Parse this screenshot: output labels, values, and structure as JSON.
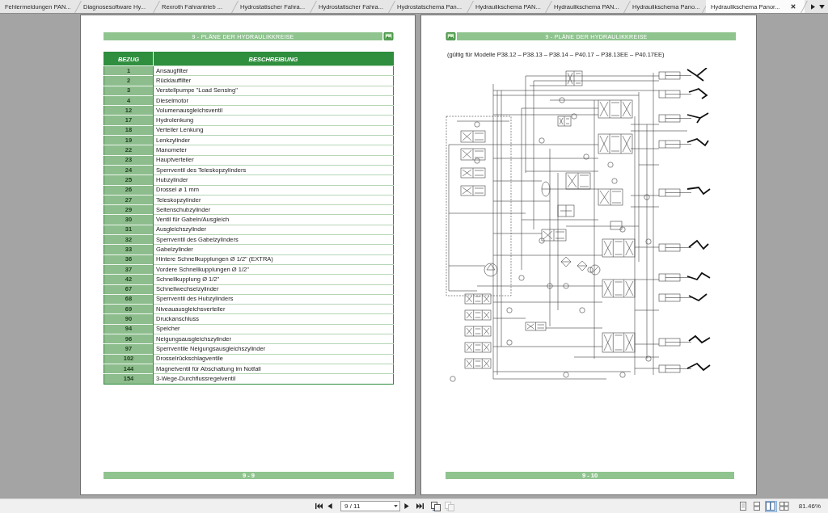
{
  "tabs": [
    {
      "label": "Fehlermeldungen PAN...",
      "selected": false
    },
    {
      "label": "Diagnosesoftware Hy...",
      "selected": false
    },
    {
      "label": "Rexroth Fahrantrieb ...",
      "selected": false
    },
    {
      "label": "Hydrostatischer Fahra...",
      "selected": false
    },
    {
      "label": "Hydrostatischer Fahra...",
      "selected": false
    },
    {
      "label": "Hydrostatschema Pan...",
      "selected": false
    },
    {
      "label": "Hydraulikschema PAN...",
      "selected": false
    },
    {
      "label": "Hydraulikschema PAN...",
      "selected": false
    },
    {
      "label": "Hydraulikschema Pano...",
      "selected": false
    },
    {
      "label": "Hydraulikschema Panor...",
      "selected": true
    }
  ],
  "pages": [
    {
      "kind": "table",
      "header": "9 - PLÄNE DER HYDRAULIKKREISE",
      "table": {
        "columns": [
          "BEZUG",
          "BESCHREIBUNG"
        ],
        "rows": [
          [
            "1",
            "Ansaugfilter"
          ],
          [
            "2",
            "Rücklauffilter"
          ],
          [
            "3",
            "Verstellpumpe \"Load Sensing\""
          ],
          [
            "4",
            "Dieselmotor"
          ],
          [
            "12",
            "Volumenausgleichsventil"
          ],
          [
            "17",
            "Hydrolenkung"
          ],
          [
            "18",
            "Verteiler Lenkung"
          ],
          [
            "19",
            "Lenkzylinder"
          ],
          [
            "22",
            "Manometer"
          ],
          [
            "23",
            "Hauptverteiler"
          ],
          [
            "24",
            "Sperrventil des Teleskopzylinders"
          ],
          [
            "25",
            "Hubzylinder"
          ],
          [
            "26",
            "Drossel ø 1 mm"
          ],
          [
            "27",
            "Teleskopzylinder"
          ],
          [
            "29",
            "Seitenschubzylinder"
          ],
          [
            "30",
            "Ventil für Gabeln/Ausgleich"
          ],
          [
            "31",
            "Ausgleichszylinder"
          ],
          [
            "32",
            "Sperrventil des Gabelzylinders"
          ],
          [
            "33",
            "Gabelzylinder"
          ],
          [
            "36",
            "Hintere Schnellkupplungen Ø 1/2\" (EXTRA)"
          ],
          [
            "37",
            "Vordere Schnellkupplungen Ø 1/2\""
          ],
          [
            "42",
            "Schnellkupplung Ø 1/2\""
          ],
          [
            "67",
            "Schnellwechselzylinder"
          ],
          [
            "68",
            "Sperrventil des Hubzylinders"
          ],
          [
            "69",
            "Niveauausgleichsverteiler"
          ],
          [
            "90",
            "Druckanschluss"
          ],
          [
            "94",
            "Speicher"
          ],
          [
            "96",
            "Neigungsausgleichszylinder"
          ],
          [
            "97",
            "Sperrventile Neigungsausgleichszylinder"
          ],
          [
            "102",
            "Drosselrückschlagventile"
          ],
          [
            "144",
            "Magnetventil für Abschaltung im Notfall"
          ],
          [
            "154",
            "3-Wege-Durchflussregelventil"
          ]
        ]
      },
      "footer": "9 - 9"
    },
    {
      "kind": "schematic",
      "header": "9 - PLÄNE DER HYDRAULIKKREISE",
      "note": "(gültig für Modelle P38.12 – P38.13 – P38.14 – P40.17 – P38.13EE – P40.17EE)",
      "footer": "9 - 10"
    }
  ],
  "toolbar": {
    "page_field": "9 / 11",
    "actions": [
      {
        "disabled": false
      },
      {
        "disabled": true
      }
    ],
    "view_modes": [
      {
        "kind": "single",
        "selected": false
      },
      {
        "kind": "continuous",
        "selected": false
      },
      {
        "kind": "facing",
        "selected": true
      },
      {
        "kind": "facing-continuous",
        "selected": false
      }
    ],
    "zoom": "81.46%"
  }
}
